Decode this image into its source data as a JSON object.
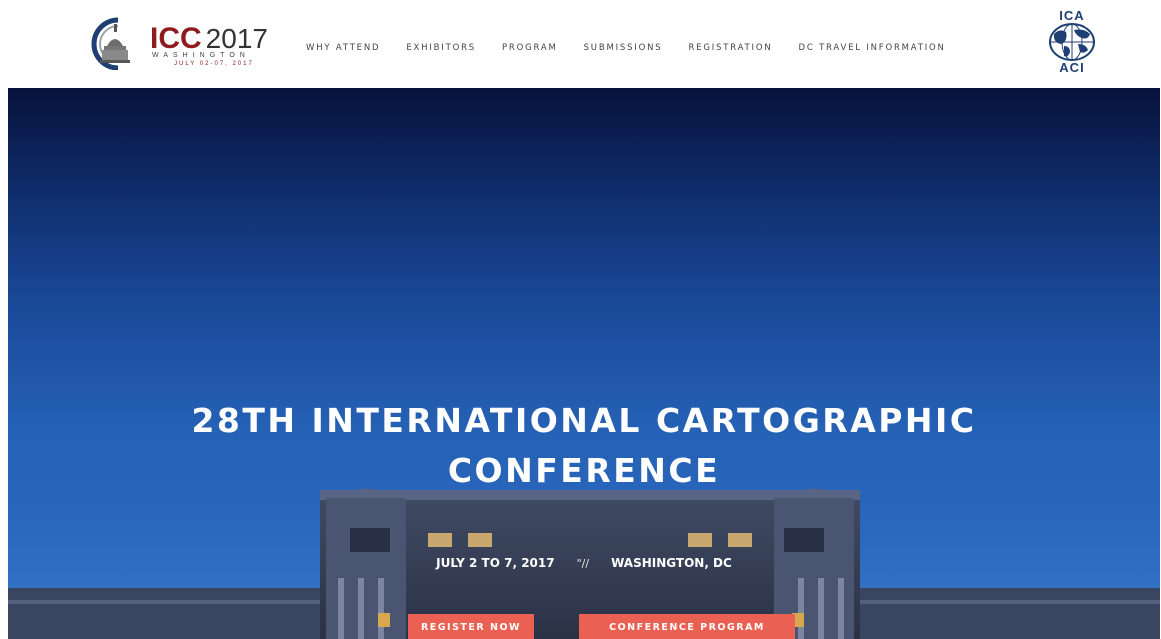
{
  "logo": {
    "icc": "ICC",
    "year": "2017",
    "city": "WASHINGTON",
    "dates": "JULY 02-07, 2017"
  },
  "nav": {
    "items": [
      "WHY ATTEND",
      "EXHIBITORS",
      "PROGRAM",
      "SUBMISSIONS",
      "REGISTRATION",
      "DC TRAVEL INFORMATION"
    ]
  },
  "ica_logo": {
    "top": "ICA",
    "bottom": "ACI"
  },
  "hero": {
    "title_line1": "28TH INTERNATIONAL CARTOGRAPHIC",
    "title_line2": "CONFERENCE",
    "dates": "JULY 2 TO 7, 2017",
    "separator": "\"//",
    "location": "WASHINGTON, DC",
    "register_label": "REGISTER NOW",
    "program_label": "CONFERENCE PROGRAM"
  },
  "colors": {
    "brand_red": "#8e1b1d",
    "button": "#ea6153",
    "ica_blue": "#1f3f74",
    "sky_top": "#07123a",
    "sky_bottom": "#3a78c8"
  }
}
